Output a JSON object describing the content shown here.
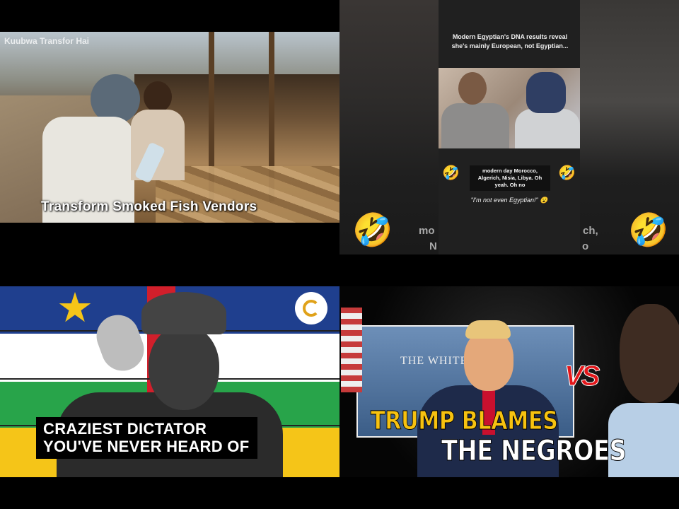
{
  "thumbnails": [
    {
      "watermark": "Kuubwa Transfor Hai",
      "caption": "Transform Smoked Fish Vendors"
    },
    {
      "caption": "Modern Egyptian's DNA results reveal she's mainly European, not Egyptian...",
      "subtitle": "modern day Morocco, Algerich, Nisia, Libya. Oh yeah. Oh no",
      "quote": "\"I'm not even Egyptian!\" 😮",
      "emoji": "🤣",
      "background_text_left": "mo",
      "background_text_left2": "N",
      "background_text_right": "ch,",
      "background_text_right2": "o"
    },
    {
      "title_line1": "CRAZIEST DICTATOR",
      "title_line2": "YOU'VE NEVER HEARD OF"
    },
    {
      "sign_text": "THE WHITE HOUSE",
      "vs_text": "VS",
      "title_line1": "TRUMP BLAMES",
      "title_line2": "THE NEGROES"
    }
  ]
}
